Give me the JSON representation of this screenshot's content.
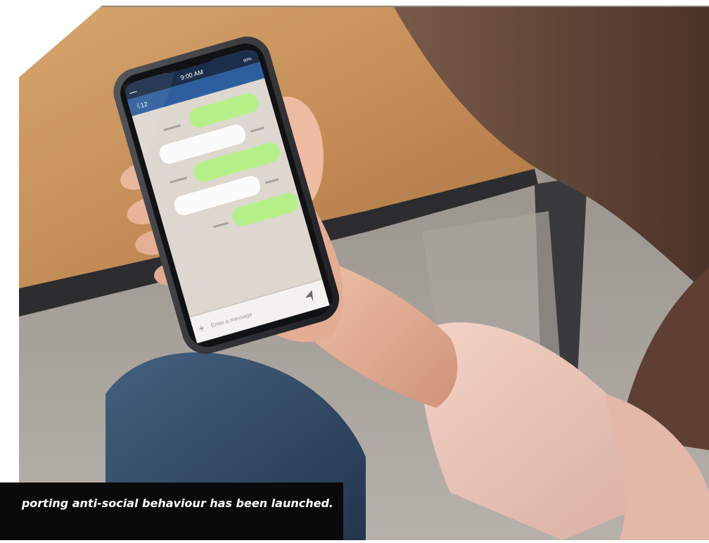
{
  "phone": {
    "time": "9:00 AM",
    "battery": "90%",
    "signal": "•••••",
    "back_count": "12",
    "compose_placeholder": "Enter a message",
    "add_symbol": "+"
  },
  "caption": {
    "text": "porting anti-social behaviour has been launched."
  },
  "colors": {
    "status_bar": "#1c2f4a",
    "header_bar": "#2d5f9e",
    "chat_background": "#ded7cf",
    "sent_bubble": "#b5f089",
    "received_bubble": "#fbfbfb",
    "caption_background": "#0a0a0a",
    "caption_text": "#ffffff"
  }
}
